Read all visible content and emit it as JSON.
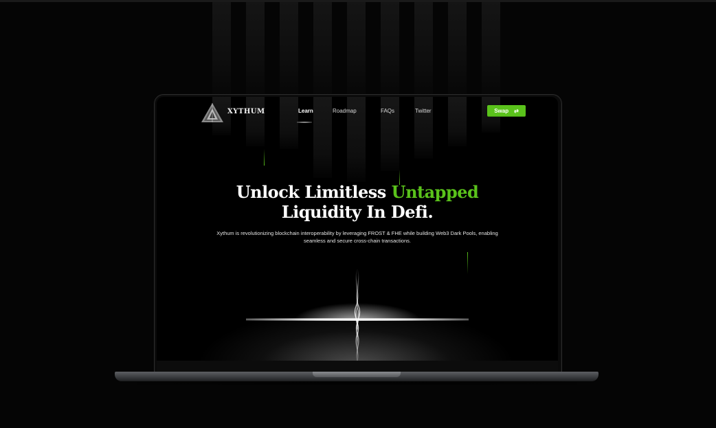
{
  "brand": {
    "name": "XYTHUM"
  },
  "nav": {
    "items": [
      {
        "label": "Learn",
        "active": true
      },
      {
        "label": "Roadmap",
        "active": false
      },
      {
        "label": "FAQs",
        "active": false
      },
      {
        "label": "Twitter",
        "active": false
      }
    ],
    "swap_button": {
      "label": "Swap",
      "icon": "swap-arrows-icon"
    }
  },
  "hero": {
    "headline_part1": "Unlock Limitless ",
    "headline_accent": "Untapped",
    "headline_part2": "Liquidity In Defi.",
    "subtitle": "Xythum is revolutionizing blockchain interoperability by leveraging FROST & FHE while building Web3 Dark Pools, enabling seamless and secure cross-chain transactions."
  },
  "colors": {
    "accent": "#5ac21b",
    "background": "#000000",
    "text": "#ffffff"
  }
}
